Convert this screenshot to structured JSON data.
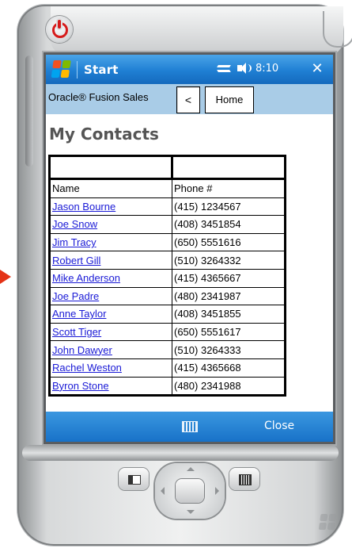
{
  "titlebar": {
    "title": "Start",
    "time": "8:10",
    "close_glyph": "✕",
    "icons": [
      "windows-start-logo",
      "connectivity-icon",
      "volume-icon",
      "close-icon"
    ]
  },
  "appbar": {
    "app_name": "Oracle® Fusion Sales",
    "back_label": "<",
    "home_label": "Home"
  },
  "page": {
    "title": "My Contacts"
  },
  "contacts": {
    "headers": {
      "name": "Name",
      "phone": "Phone #"
    },
    "filters": {
      "name": "",
      "phone": ""
    },
    "rows": [
      {
        "name": "Jason Bourne",
        "phone": "(415) 1234567"
      },
      {
        "name": "Joe Snow",
        "phone": "(408) 3451854"
      },
      {
        "name": "Jim Tracy",
        "phone": "(650) 5551616"
      },
      {
        "name": "Robert Gill",
        "phone": "(510) 3264332"
      },
      {
        "name": "Mike Anderson",
        "phone": "(415) 4365667"
      },
      {
        "name": "Joe Padre",
        "phone": "(480) 2341987"
      },
      {
        "name": "Anne Taylor",
        "phone": "(408) 3451855"
      },
      {
        "name": "Scott Tiger",
        "phone": "(650) 5551617"
      },
      {
        "name": "John Dawyer",
        "phone": "(510) 3264333"
      },
      {
        "name": "Rachel Weston",
        "phone": "(415) 4365668"
      },
      {
        "name": "Byron Stone",
        "phone": "(480) 2341988"
      }
    ]
  },
  "menubar": {
    "close_label": "Close"
  },
  "colors": {
    "titlebar_blue": "#1f7fd3",
    "appbar_blue": "#a9cce7",
    "link_blue": "#1a1ad6",
    "power_red": "#d61b1b",
    "pointer_red": "#e43216"
  }
}
